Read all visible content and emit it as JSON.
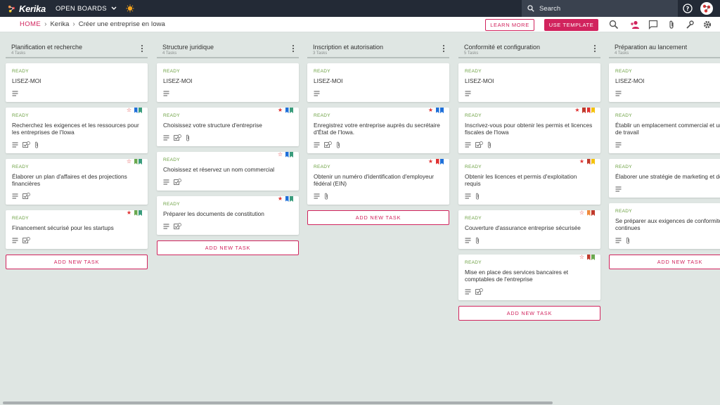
{
  "app": {
    "name": "Kerika",
    "boards_menu_label": "OPEN BOARDS",
    "search_placeholder": "Search"
  },
  "breadcrumb": {
    "home": "HOME",
    "org": "Kerika",
    "board": "Créer une entreprise en Iowa"
  },
  "actions": {
    "learn_more": "LEARN MORE",
    "use_template": "USE TEMPLATE"
  },
  "colors": {
    "accent": "#d1235d",
    "topbar": "#232a36",
    "ready_green": "#6a9f3f",
    "board_bg": "#dfe6e3"
  },
  "add_task_label": "ADD NEW TASK",
  "columns": [
    {
      "title": "Planification et recherche",
      "count": "4 Tasks",
      "cards": [
        {
          "status": "READY",
          "title": "LISEZ-MOI",
          "meta": [
            "desc"
          ],
          "star": "",
          "flags": []
        },
        {
          "status": "READY",
          "title": "Recherchez les exigences et les ressources pour les entreprises de l'Iowa",
          "meta": [
            "desc",
            "check",
            "attach"
          ],
          "star": "outline",
          "flags": [
            "#1e6fd9",
            "#3a9c7c"
          ]
        },
        {
          "status": "READY",
          "title": "Élaborer un plan d'affaires et des projections financières",
          "meta": [
            "desc",
            "check"
          ],
          "star": "outline",
          "flags": [
            "#6aa84f",
            "#3a9c7c"
          ]
        },
        {
          "status": "READY",
          "title": "Financement sécurisé pour les startups",
          "meta": [
            "desc",
            "check"
          ],
          "star": "filled",
          "flags": [
            "#6aa84f",
            "#3a9c7c"
          ]
        }
      ]
    },
    {
      "title": "Structure juridique",
      "count": "4 Tasks",
      "cards": [
        {
          "status": "READY",
          "title": "LISEZ-MOI",
          "meta": [
            "desc"
          ],
          "star": "",
          "flags": []
        },
        {
          "status": "READY",
          "title": "Choisissez votre structure d'entreprise",
          "meta": [
            "desc",
            "check",
            "attach"
          ],
          "star": "filled",
          "flags": [
            "#1e6fd9",
            "#3a9c7c"
          ]
        },
        {
          "status": "READY",
          "title": "Choisissez et réservez un nom commercial",
          "meta": [
            "desc",
            "check"
          ],
          "star": "outline",
          "flags": [
            "#1e6fd9",
            "#3a9c7c"
          ]
        },
        {
          "status": "READY",
          "title": "Préparer les documents de constitution",
          "meta": [
            "desc",
            "check"
          ],
          "star": "filled",
          "flags": [
            "#1e6fd9",
            "#3a9c7c"
          ]
        }
      ]
    },
    {
      "title": "Inscription et autorisation",
      "count": "3 Tasks",
      "cards": [
        {
          "status": "READY",
          "title": "LISEZ-MOI",
          "meta": [
            "desc"
          ],
          "star": "",
          "flags": []
        },
        {
          "status": "READY",
          "title": "Enregistrez votre entreprise auprès du secrétaire d'État de l'Iowa.",
          "meta": [
            "desc",
            "check",
            "attach"
          ],
          "star": "filled",
          "flags": [
            "#1e6fd9",
            "#1e6fd9"
          ]
        },
        {
          "status": "READY",
          "title": "Obtenir un numéro d'identification d'employeur fédéral (EIN)",
          "meta": [
            "desc",
            "attach"
          ],
          "star": "filled",
          "flags": [
            "#e03131",
            "#1e6fd9"
          ]
        }
      ]
    },
    {
      "title": "Conformité et configuration",
      "count": "5 Tasks",
      "cards": [
        {
          "status": "READY",
          "title": "LISEZ-MOI",
          "meta": [
            "desc"
          ],
          "star": "",
          "flags": []
        },
        {
          "status": "READY",
          "title": "Inscrivez-vous pour obtenir les permis et licences fiscales de l'Iowa",
          "meta": [
            "desc",
            "check",
            "attach"
          ],
          "star": "filled",
          "flags": [
            "#c0392b",
            "#e03131",
            "#f4c20d"
          ]
        },
        {
          "status": "READY",
          "title": "Obtenir les licences et permis d'exploitation requis",
          "meta": [
            "desc",
            "attach"
          ],
          "star": "filled",
          "flags": [
            "#c0392b",
            "#f4c20d"
          ]
        },
        {
          "status": "READY",
          "title": "Couverture d'assurance entreprise sécurisée",
          "meta": [
            "desc",
            "attach"
          ],
          "star": "outline",
          "flags": [
            "#f08a3c",
            "#c0392b"
          ]
        },
        {
          "status": "READY",
          "title": "Mise en place des services bancaires et comptables de l'entreprise",
          "meta": [
            "desc",
            "check"
          ],
          "star": "outline",
          "flags": [
            "#c0392b",
            "#6aa84f"
          ]
        }
      ]
    },
    {
      "title": "Préparation au lancement",
      "count": "4 Tasks",
      "cards": [
        {
          "status": "READY",
          "title": "LISEZ-MOI",
          "meta": [
            "desc"
          ],
          "star": "",
          "flags": []
        },
        {
          "status": "READY",
          "title": "Établir un emplacement commercial et un espace de travail",
          "meta": [
            "desc"
          ],
          "star": "",
          "flags": []
        },
        {
          "status": "READY",
          "title": "Élaborer une stratégie de marketing et de",
          "meta": [
            "desc"
          ],
          "star": "",
          "flags": []
        },
        {
          "status": "READY",
          "title": "Se préparer aux exigences de conformité continues",
          "meta": [
            "desc",
            "attach"
          ],
          "star": "",
          "flags": []
        }
      ]
    }
  ]
}
